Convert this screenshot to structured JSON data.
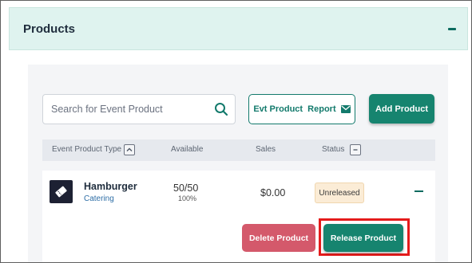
{
  "section": {
    "title": "Products"
  },
  "search": {
    "placeholder": "Search for Event Product"
  },
  "toolbar": {
    "report_label": "Evt Product  Report",
    "add_label": "Add Product"
  },
  "table": {
    "columns": [
      "Event Product Type",
      "Available",
      "Sales",
      "Status"
    ],
    "rows": [
      {
        "name": "Hamburger",
        "category": "Catering",
        "available": "50/50",
        "available_pct": "100%",
        "sales": "$0.00",
        "status": "Unreleased"
      }
    ]
  },
  "row_actions": {
    "delete_label": "Delete Product",
    "release_label": "Release Product"
  },
  "colors": {
    "accent": "#16846f",
    "danger": "#d4596b",
    "highlight": "#e41b1b",
    "header_bg": "#dff3ef",
    "status_bg": "#fbecd6"
  },
  "icons": {
    "search": "search-icon",
    "report": "envelope-icon",
    "product": "ticket-icon",
    "sort_type": "chevron-up-icon",
    "sort_status": "minus-icon",
    "collapse": "minus-icon"
  }
}
